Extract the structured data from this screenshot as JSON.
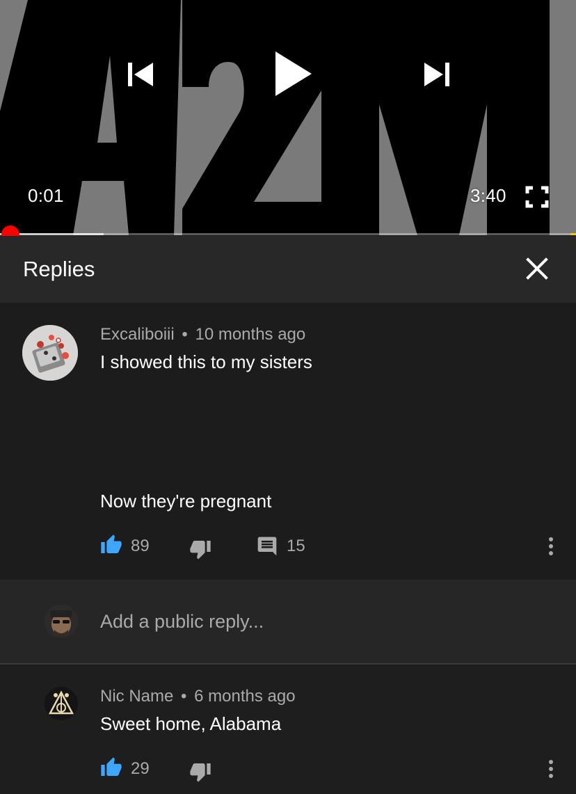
{
  "player": {
    "artwork_text": "A2M",
    "current_time": "0:01",
    "total_time": "3:40",
    "progress_fraction": 0.005,
    "buffered_fraction": 0.18,
    "accent_color": "#ff0000"
  },
  "replies_panel": {
    "title": "Replies"
  },
  "comment": {
    "author": "Excaliboiii",
    "separator": "•",
    "time_ago": "10 months ago",
    "text_line_1": "I showed this to my sisters",
    "text_line_2": "Now they're pregnant",
    "likes": "89",
    "replies": "15",
    "like_color": "#3ea6ff"
  },
  "reply_box": {
    "placeholder": "Add a public reply..."
  },
  "reply": {
    "author": "Nic Name",
    "separator": "•",
    "time_ago": "6 months ago",
    "text": "Sweet home, Alabama",
    "likes": "29"
  },
  "icons": {
    "player_prev": "skip-previous-icon",
    "player_play": "play-icon",
    "player_next": "skip-next-icon",
    "player_fullscreen": "fullscreen-icon",
    "close": "close-icon",
    "like": "thumbs-up-icon",
    "dislike": "thumbs-down-icon",
    "reply": "comment-icon",
    "more": "more-vertical-icon"
  }
}
